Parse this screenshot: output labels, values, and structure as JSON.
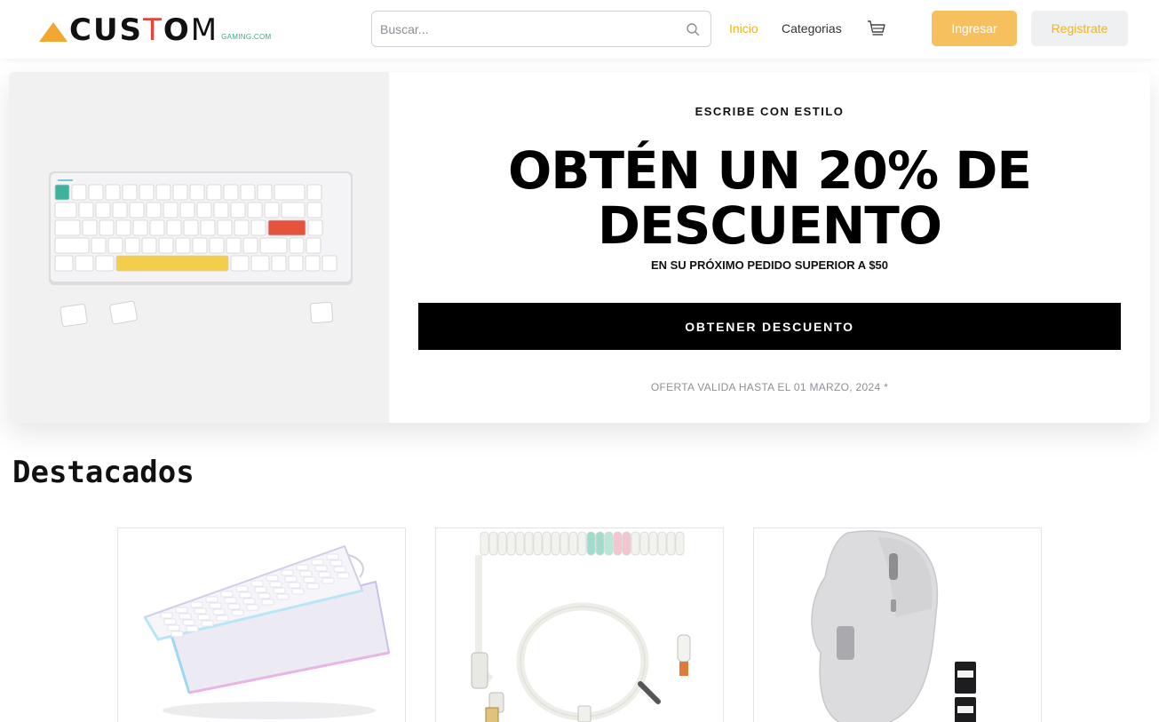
{
  "brand": {
    "logo_main": "CUSTOM",
    "logo_sub": "GAMING.COM"
  },
  "search": {
    "placeholder": "Buscar..."
  },
  "nav": {
    "inicio": "Inicio",
    "categorias": "Categorias"
  },
  "auth": {
    "login": "Ingresar",
    "register": "Registrate"
  },
  "hero": {
    "eyebrow": "ESCRIBE CON ESTILO",
    "title_line1": "OBTÉN UN 20% DE",
    "title_line2": "DESCUENTO",
    "subtitle": "EN SU PRÓXIMO PEDIDO SUPERIOR A $50",
    "cta": "OBTENER DESCUENTO",
    "note": "OFERTA VALIDA HASTA EL 01 MARZO, 2024 *"
  },
  "featured": {
    "title": "Destacados",
    "products": [
      {
        "image": "rgb-keyboard-exploded"
      },
      {
        "image": "coiled-cable"
      },
      {
        "image": "wireless-mouse"
      }
    ]
  },
  "colors": {
    "accent": "#f2b320",
    "login_bg": "#f7c05f",
    "register_bg": "#eef0f2",
    "logo_triangle": "#f3a733",
    "logo_red": "#e8433b",
    "cta_bg": "#000000"
  }
}
